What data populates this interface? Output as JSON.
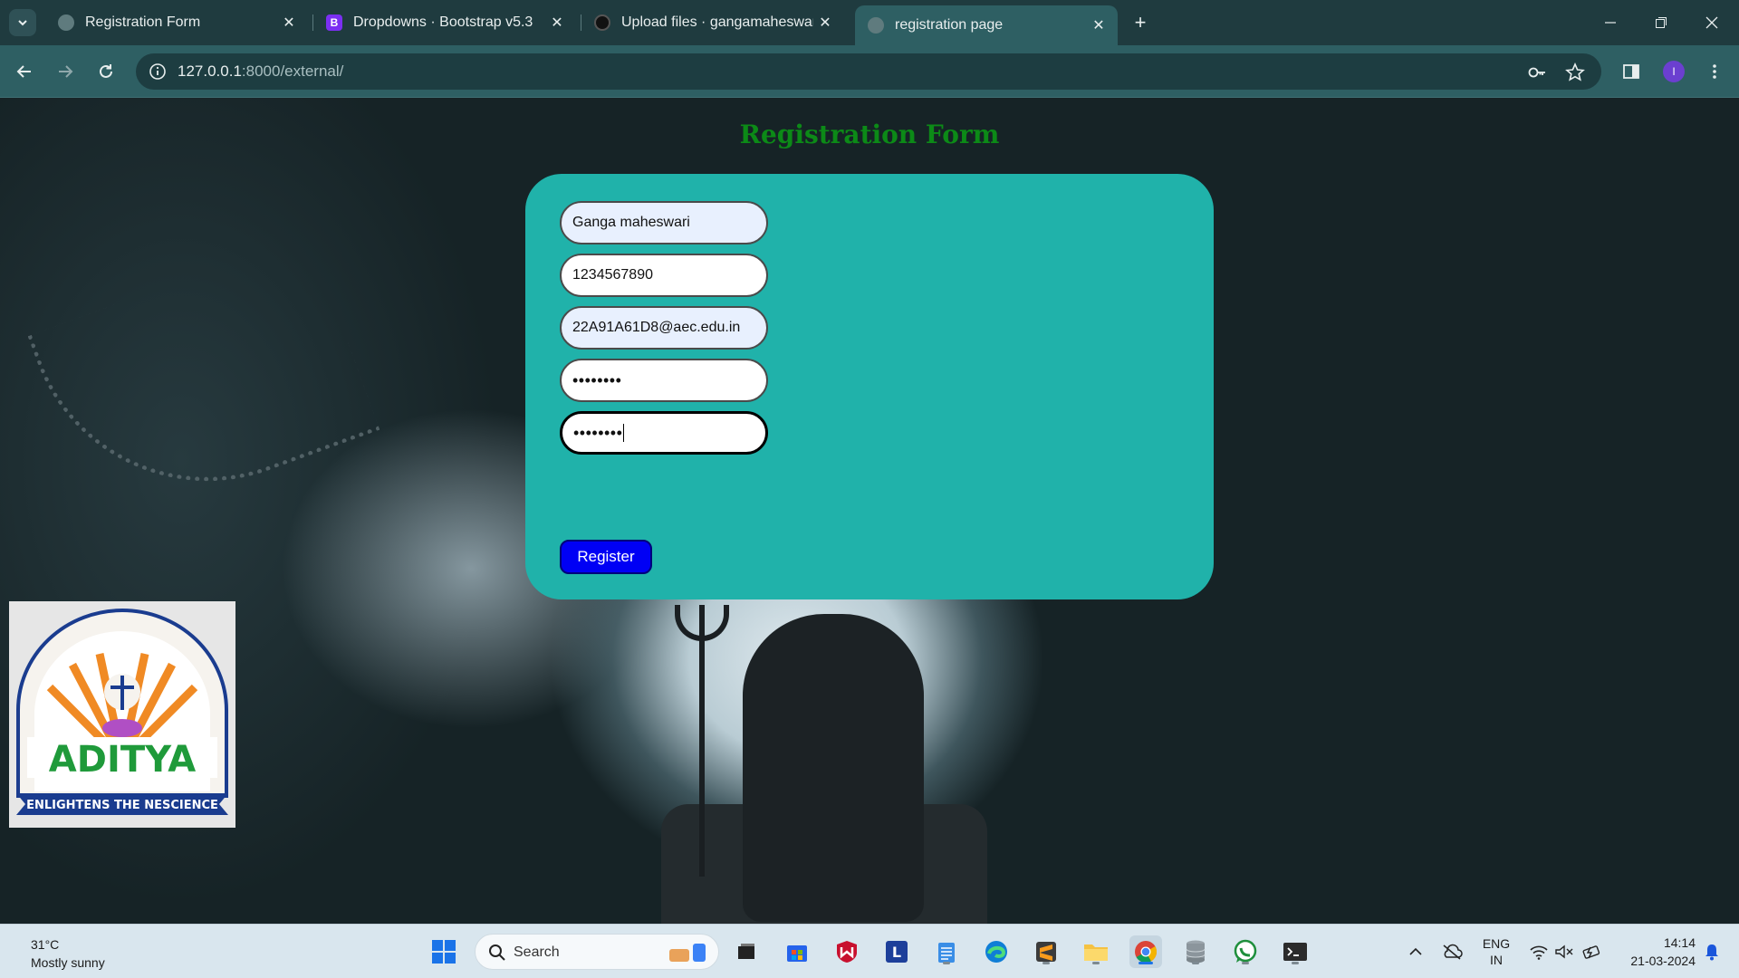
{
  "browser": {
    "tabs": [
      {
        "title": "Registration Form",
        "active": false
      },
      {
        "title": "Dropdowns · Bootstrap v5.3",
        "active": false
      },
      {
        "title": "Upload files · gangamaheswari/",
        "active": false
      },
      {
        "title": "registration page",
        "active": true
      }
    ],
    "url_host": "127.0.0.1",
    "url_rest": ":8000/external/",
    "profile_initial": "I"
  },
  "page": {
    "heading": "Registration Form",
    "fields": {
      "name": "Ganga maheswari",
      "phone": "1234567890",
      "email": "22A91A61D8@aec.edu.in",
      "password": "••••••••",
      "confirm_password": "••••••••"
    },
    "register_label": "Register",
    "logo": {
      "text": "ADITYA",
      "tagline": "ENLIGHTENS THE NESCIENCE"
    }
  },
  "taskbar": {
    "weather_temp": "31°C",
    "weather_desc": "Mostly sunny",
    "search_label": "Search",
    "lang_1": "ENG",
    "lang_2": "IN",
    "time": "14:14",
    "date": "21-03-2024"
  },
  "colors": {
    "card": "#20b2aa",
    "heading": "#0c8a17",
    "button": "#0000f5"
  }
}
